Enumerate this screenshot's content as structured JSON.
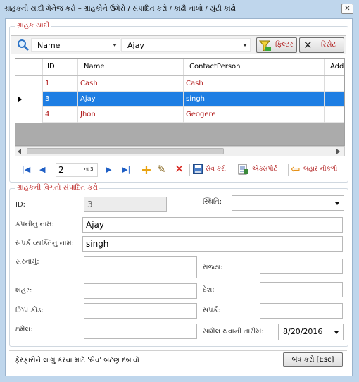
{
  "window": {
    "title": "ગ્રાહકની યાદી મેનેજ કરો – ગ્રાહકોને ઉમેરો / સંપાદિત કરો / કાઢી નાખો / યુંટી કાઢો",
    "close_label": "✕"
  },
  "list_group": {
    "legend": "ગ્રાહક યાદી"
  },
  "search": {
    "field_value": "Name",
    "query_value": "Ajay",
    "filter_label": "ફિલ્ટર",
    "reset_label": "રિસેટ"
  },
  "grid": {
    "columns": [
      "ID",
      "Name",
      "ContactPerson",
      "Addr"
    ],
    "rows": [
      {
        "id": "1",
        "name": "Cash",
        "contact": "Cash"
      },
      {
        "id": "3",
        "name": "Ajay",
        "contact": "singh"
      },
      {
        "id": "4",
        "name": "Jhon",
        "contact": "Geogere"
      }
    ],
    "selected_row": 1
  },
  "pager": {
    "current": "2",
    "of_text": "ના 3",
    "save_label": "સેવ કરો",
    "export_label": "એક્સપોર્ટ",
    "exit_label": "બહાર નીકળો"
  },
  "edit_group": {
    "legend": "ગ્રાહકની વિગતો સંપાદિત કરો"
  },
  "form": {
    "id_label": "ID:",
    "id_value": "3",
    "status_label": "સ્થિતિ:",
    "status_value": "",
    "company_label": "કંપનીનું નામ:",
    "company_value": "Ajay",
    "contact_label": "સંપર્ક વ્યક્તિનું નામ:",
    "contact_value": "singh",
    "address_label": "સરનામું:",
    "address_value": "",
    "state_label": "રાજ્ય:",
    "state_value": "",
    "city_label": "શહર:",
    "city_value": "",
    "country_label": "દેશ:",
    "country_value": "",
    "zip_label": "ઝિપ કોડ:",
    "zip_value": "",
    "phone_label": "સંપર્ક:",
    "phone_value": "",
    "email_label": "ઇમેલ:",
    "email_value": "",
    "join_date_label": "સામેલ થવાની તારીખ:",
    "join_date_value": "8/20/2016"
  },
  "status_bar": {
    "hint": "ફેરફારોને લાગુ કરવા માટે 'સેવ' બટણ દબાવો",
    "close_button": "બંધ કરો [Esc]"
  },
  "colors": {
    "selected_row": "#1e7ee3",
    "label_red": "#b01a1a",
    "window_bg": "#bfd6ec"
  }
}
